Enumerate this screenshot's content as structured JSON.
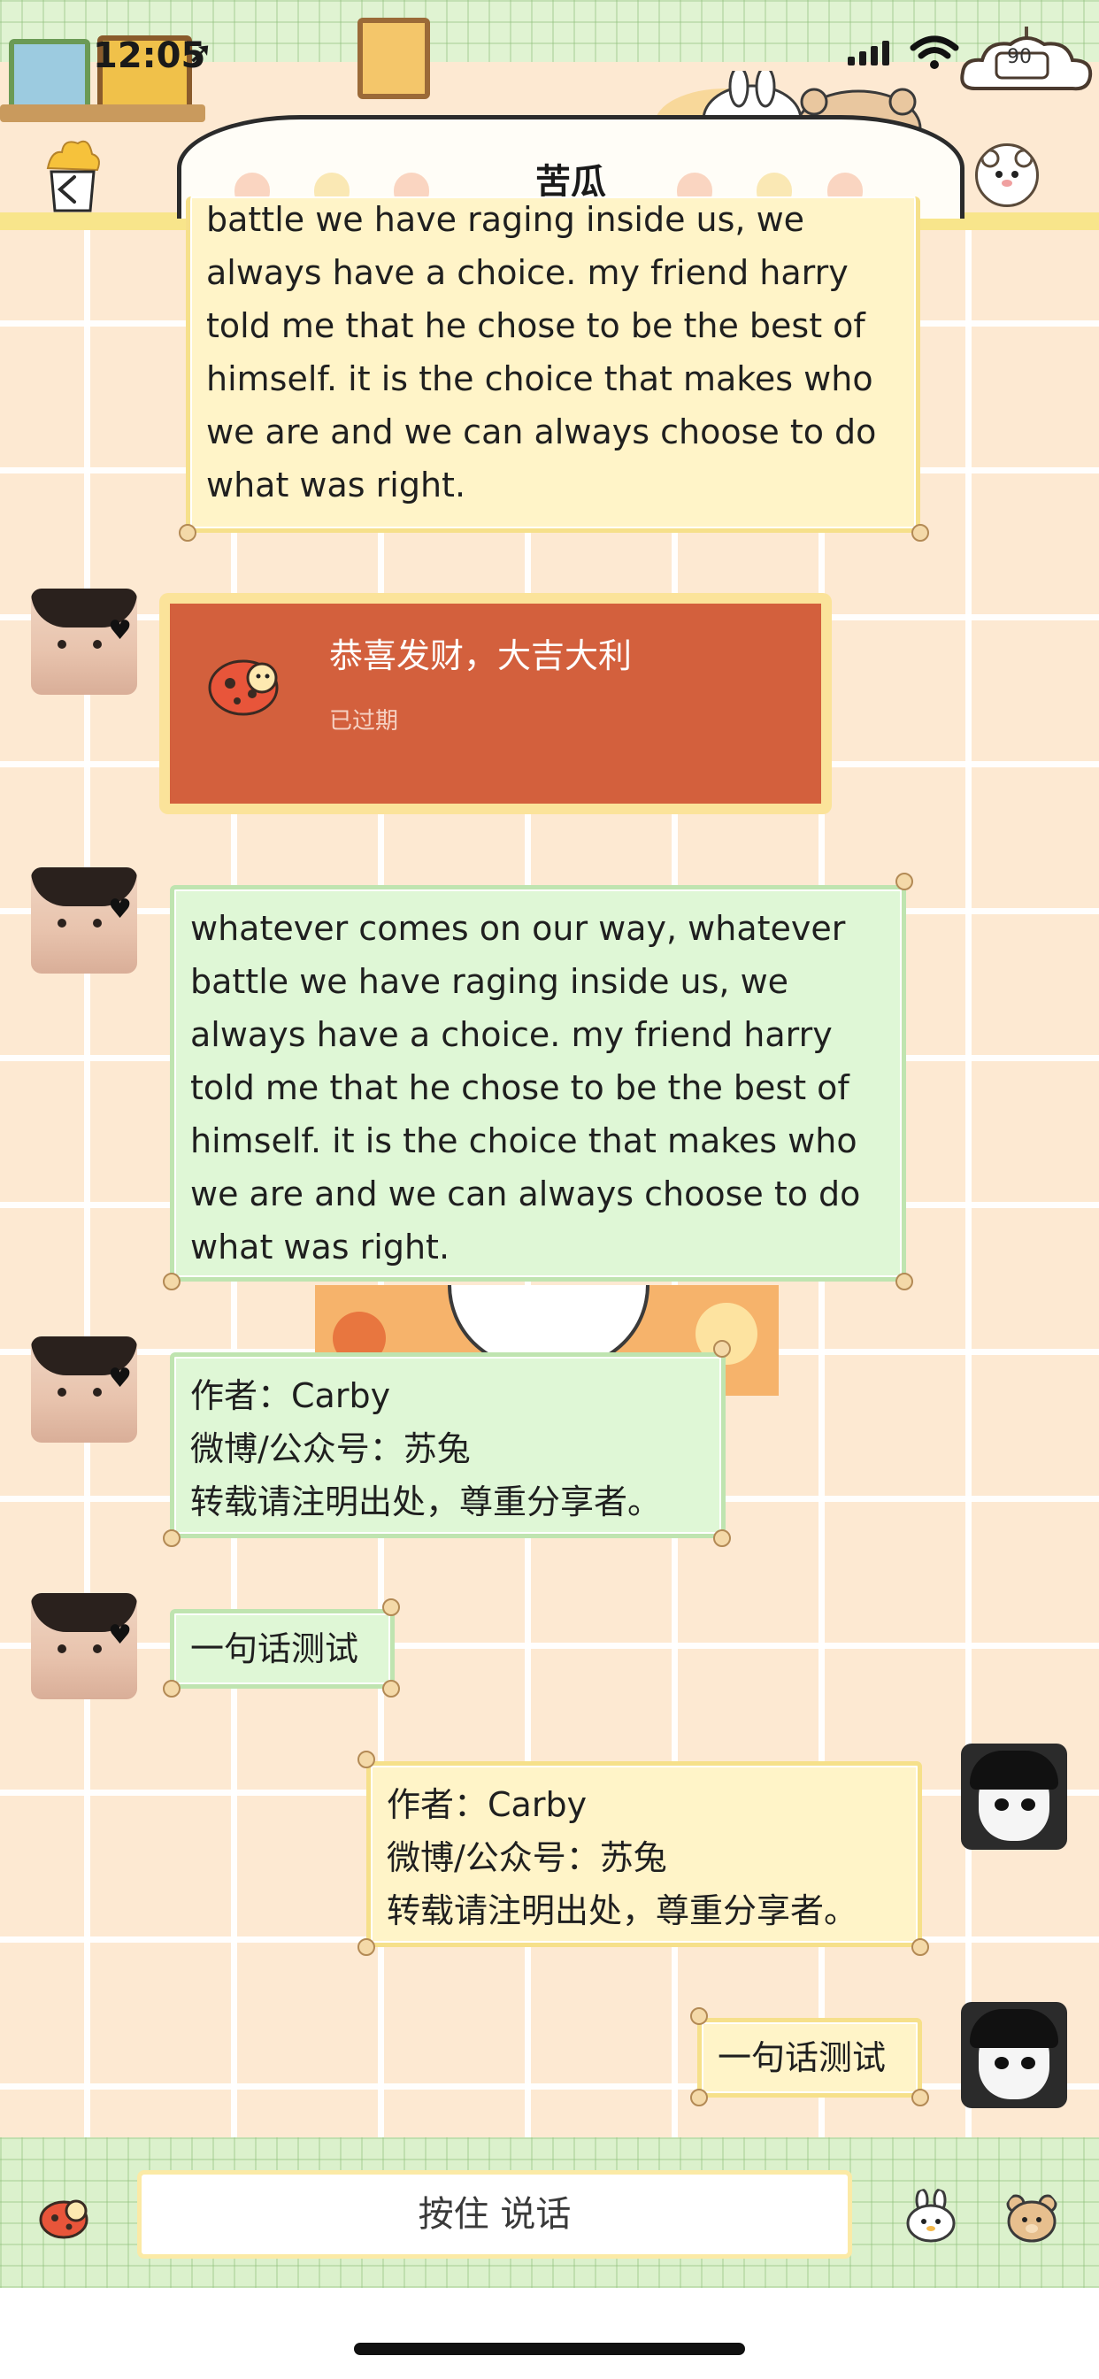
{
  "status_bar": {
    "time": "12:05",
    "battery": "90"
  },
  "header": {
    "title": "苦瓜"
  },
  "messages": {
    "m1": {
      "lines": [
        "battle we have raging inside us, we",
        "always have a choice. my friend harry",
        "told me that he chose to be the best of",
        "himself. it is the choice that makes who",
        "we are and we can always choose to do",
        " what was right."
      ]
    },
    "red_packet": {
      "title": "恭喜发财，大吉大利",
      "status": "已过期"
    },
    "m2": {
      "lines": [
        "whatever comes on our way, whatever",
        "battle we have raging inside us, we",
        "always have a choice. my friend harry",
        "told me that he chose to be the best of",
        "himself. it is the choice that makes who",
        "we are and we can always choose to do",
        " what was right."
      ]
    },
    "m3": {
      "lines": [
        "作者：Carby",
        "微博/公众号：苏兔",
        "转载请注明出处，尊重分享者。"
      ]
    },
    "m4": {
      "text": "一句话测试"
    },
    "m5": {
      "lines": [
        "作者：Carby",
        "微博/公众号：苏兔",
        "转载请注明出处，尊重分享者。"
      ]
    },
    "m6": {
      "text": "一句话测试"
    }
  },
  "input_bar": {
    "talk_label": "按住 说话"
  },
  "colors": {
    "background": "#fde9d2",
    "incoming_bubble": "#dff7d6",
    "outgoing_bubble": "#fff4c8",
    "red_packet": "#d3603d",
    "bar_green": "#dbf1cc"
  },
  "icons": [
    "back-arrow-icon",
    "bear-face-icon",
    "ladybug-icon",
    "bunny-icon",
    "bear-icon",
    "signal-icon",
    "wifi-icon",
    "battery-cloud-icon",
    "location-arrow-icon"
  ]
}
